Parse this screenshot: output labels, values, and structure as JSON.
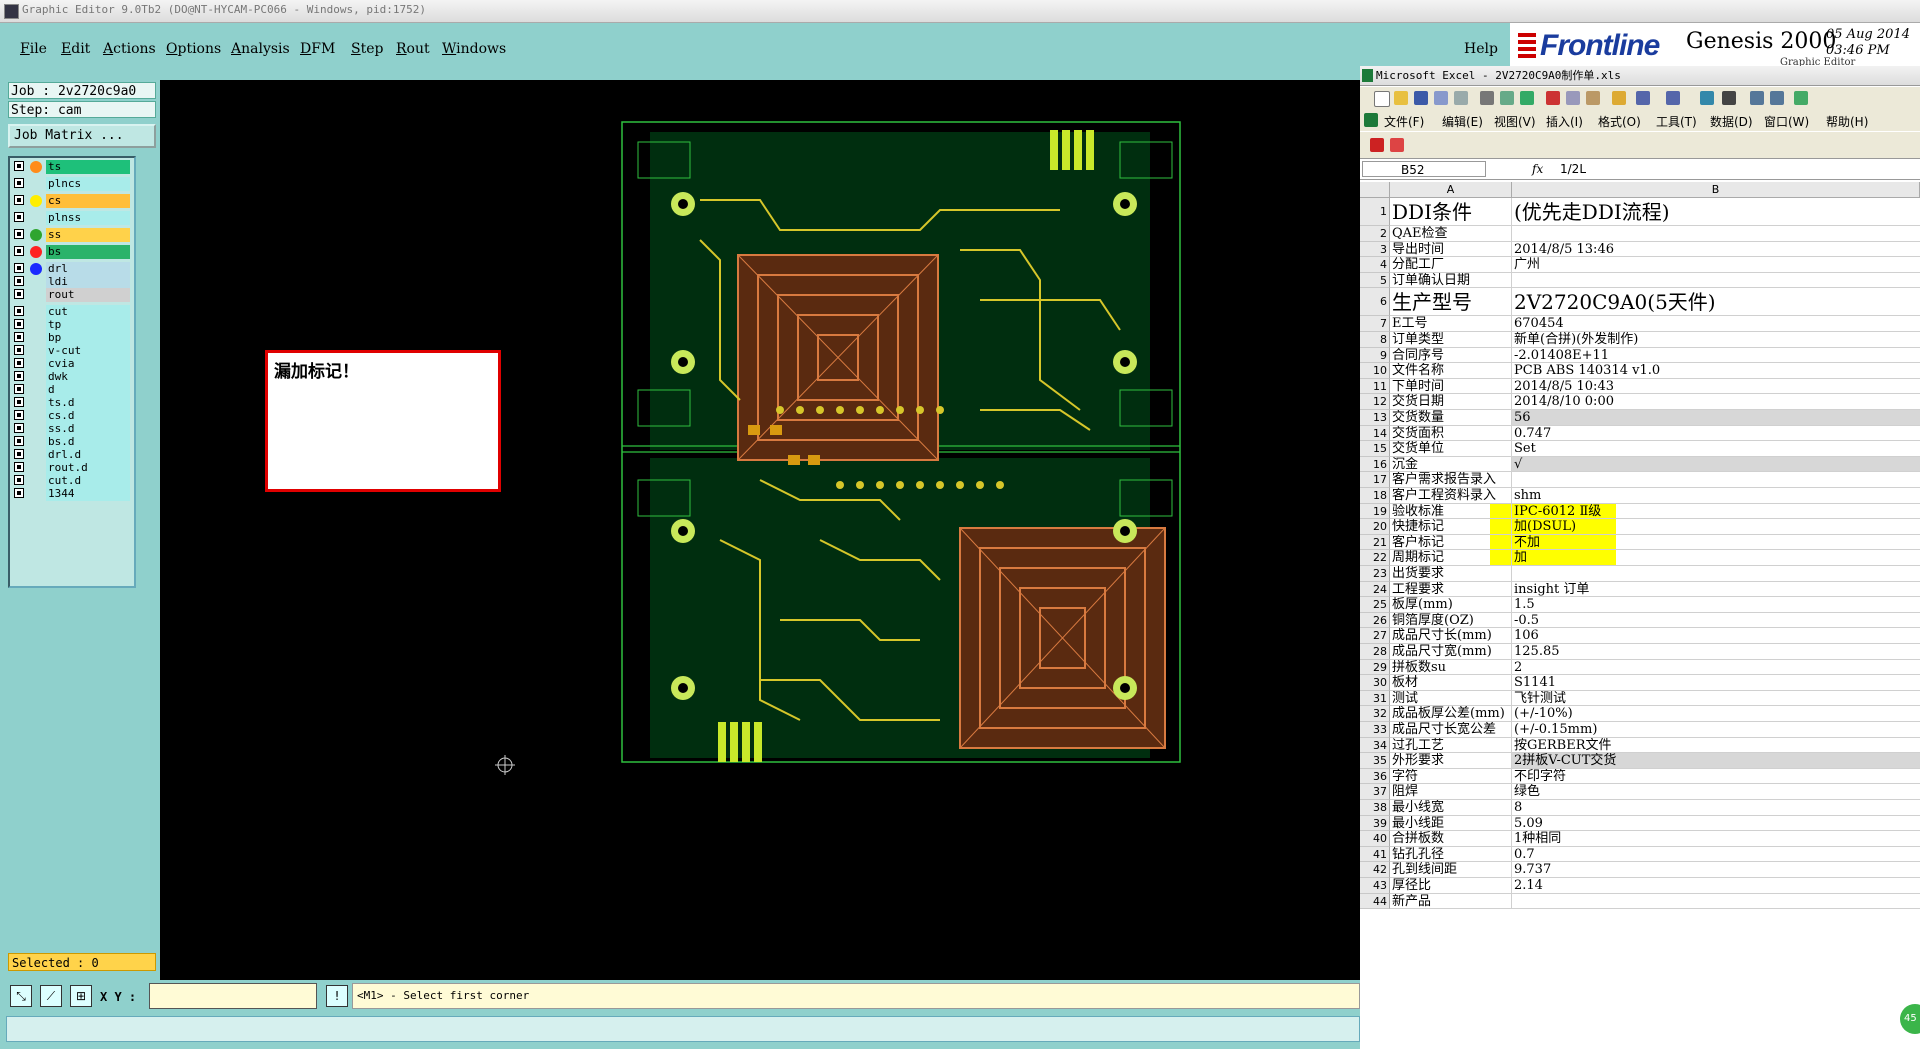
{
  "window": {
    "title": "Graphic Editor 9.0Tb2 (DO@NT-HYCAM-PC066 - Windows, pid:1752)"
  },
  "menu": {
    "items": [
      "File",
      "Edit",
      "Actions",
      "Options",
      "Analysis",
      "DFM",
      "Step",
      "Rout",
      "Windows"
    ],
    "help": "Help"
  },
  "logo": {
    "brand": "Frontline",
    "product": "Genesis 2000",
    "date": "05 Aug 2014",
    "time": "03:46 PM",
    "sub": "Graphic Editor"
  },
  "job": {
    "job_line": "Job : 2v2720c9a0",
    "step_line": "Step: cam",
    "matrix_button": "Job Matrix ..."
  },
  "layers": [
    {
      "name": "ts",
      "color": "#ff8c1a",
      "bg": "#1ec07a"
    },
    {
      "name": "plncs",
      "color": "",
      "bg": "#a8ecea"
    },
    {
      "name": "cs",
      "color": "#ffee00",
      "bg": "#ffbe3a"
    },
    {
      "name": "plnss",
      "color": "",
      "bg": "#a8ecea"
    },
    {
      "name": "ss",
      "color": "#2fa52f",
      "bg": "#ffd24a"
    },
    {
      "name": "bs",
      "color": "#ff2222",
      "bg": "#2ab36a"
    },
    {
      "name": "drl",
      "color": "#1a2aff",
      "bg": "#b8dce8"
    },
    {
      "name": "ldi",
      "color": "",
      "bg": "#b8dce8"
    },
    {
      "name": "rout",
      "color": "",
      "bg": "#d0d0d0"
    },
    {
      "name": "cut",
      "color": "",
      "bg": "#a8ecea"
    },
    {
      "name": "tp",
      "color": "",
      "bg": "#a8ecea"
    },
    {
      "name": "bp",
      "color": "",
      "bg": "#a8ecea"
    },
    {
      "name": "v-cut",
      "color": "",
      "bg": "#a8ecea"
    },
    {
      "name": "cvia",
      "color": "",
      "bg": "#a8ecea"
    },
    {
      "name": "dwk",
      "color": "",
      "bg": "#a8ecea"
    },
    {
      "name": "d",
      "color": "",
      "bg": "#a8ecea"
    },
    {
      "name": "ts.d",
      "color": "",
      "bg": "#a8ecea"
    },
    {
      "name": "cs.d",
      "color": "",
      "bg": "#a8ecea"
    },
    {
      "name": "ss.d",
      "color": "",
      "bg": "#a8ecea"
    },
    {
      "name": "bs.d",
      "color": "",
      "bg": "#a8ecea"
    },
    {
      "name": "drl.d",
      "color": "",
      "bg": "#a8ecea"
    },
    {
      "name": "rout.d",
      "color": "",
      "bg": "#a8ecea"
    },
    {
      "name": "cut.d",
      "color": "",
      "bg": "#a8ecea"
    },
    {
      "name": "1344",
      "color": "",
      "bg": "#a8ecea"
    }
  ],
  "selected": "Selected : 0",
  "popup": {
    "text": "漏加标记！"
  },
  "bottom": {
    "xy_label": "X Y :",
    "xy_value": "",
    "prompt": "<M1> - Select first corner",
    "info_button": "!"
  },
  "excel": {
    "title": "Microsoft Excel - 2V2720C9A0制作单.xls",
    "menu": [
      "文件(F)",
      "编辑(E)",
      "视图(V)",
      "插入(I)",
      "格式(O)",
      "工具(T)",
      "数据(D)",
      "窗口(W)",
      "帮助(H)"
    ],
    "cell_ref": "B52",
    "formula": "1/2L",
    "col_a": "A",
    "col_b": "B",
    "rows": [
      {
        "n": "1",
        "a": "DDI条件",
        "b": "(优先走DDI流程)",
        "big": true
      },
      {
        "n": "2",
        "a": "QAE检查",
        "b": ""
      },
      {
        "n": "3",
        "a": "导出时间",
        "b": "2014/8/5 13:46"
      },
      {
        "n": "4",
        "a": "分配工厂",
        "b": "广州"
      },
      {
        "n": "5",
        "a": "订单确认日期",
        "b": ""
      },
      {
        "n": "6",
        "a": "生产型号",
        "b": "2V2720C9A0(5天件)",
        "big": true
      },
      {
        "n": "7",
        "a": "E工号",
        "b": "670454"
      },
      {
        "n": "8",
        "a": "订单类型",
        "b": "新单(合拼)(外发制作)"
      },
      {
        "n": "9",
        "a": "合同序号",
        "b": "-2.01408E+11"
      },
      {
        "n": "10",
        "a": "文件名称",
        "b": "PCB ABS 140314 v1.0"
      },
      {
        "n": "11",
        "a": "下单时间",
        "b": "2014/8/5 10:43"
      },
      {
        "n": "12",
        "a": "交货日期",
        "b": "2014/8/10 0:00"
      },
      {
        "n": "13",
        "a": "交货数量",
        "b": "56",
        "grey": true
      },
      {
        "n": "14",
        "a": "交货面积",
        "b": "0.747"
      },
      {
        "n": "15",
        "a": "交货单位",
        "b": "Set"
      },
      {
        "n": "16",
        "a": "沉金",
        "b": "√",
        "grey": true
      },
      {
        "n": "17",
        "a": "客户需求报告录入",
        "b": ""
      },
      {
        "n": "18",
        "a": "客户工程资料录入",
        "b": "shm"
      },
      {
        "n": "19",
        "a": "验收标准",
        "b": "IPC-6012 Ⅱ级",
        "yellow": true
      },
      {
        "n": "20",
        "a": "快捷标记",
        "b": "加(DSUL)",
        "yellow": true
      },
      {
        "n": "21",
        "a": "客户标记",
        "b": "不加",
        "yellow": true
      },
      {
        "n": "22",
        "a": "周期标记",
        "b": "加",
        "yellow": true
      },
      {
        "n": "23",
        "a": "出货要求",
        "b": ""
      },
      {
        "n": "24",
        "a": "工程要求",
        "b": "insight 订单"
      },
      {
        "n": "25",
        "a": "板厚(mm)",
        "b": "1.5"
      },
      {
        "n": "26",
        "a": "铜箔厚度(OZ)",
        "b": "-0.5"
      },
      {
        "n": "27",
        "a": "成品尺寸长(mm)",
        "b": "106"
      },
      {
        "n": "28",
        "a": "成品尺寸宽(mm)",
        "b": "125.85"
      },
      {
        "n": "29",
        "a": "拼板数su",
        "b": "2"
      },
      {
        "n": "30",
        "a": "板材",
        "b": "S1141"
      },
      {
        "n": "31",
        "a": "测试",
        "b": "飞针测试"
      },
      {
        "n": "32",
        "a": "成品板厚公差(mm)",
        "b": "(+/-10%)"
      },
      {
        "n": "33",
        "a": "成品尺寸长宽公差",
        "b": "(+/-0.15mm)"
      },
      {
        "n": "34",
        "a": "过孔工艺",
        "b": "按GERBER文件"
      },
      {
        "n": "35",
        "a": "外形要求",
        "b": "2拼板V-CUT交货",
        "grey": true
      },
      {
        "n": "36",
        "a": "字符",
        "b": "不印字符"
      },
      {
        "n": "37",
        "a": "阻焊",
        "b": "绿色"
      },
      {
        "n": "38",
        "a": "最小线宽",
        "b": "8"
      },
      {
        "n": "39",
        "a": "最小线距",
        "b": "5.09"
      },
      {
        "n": "40",
        "a": "合拼板数",
        "b": "1种相同"
      },
      {
        "n": "41",
        "a": "钻孔孔径",
        "b": "0.7"
      },
      {
        "n": "42",
        "a": "孔到线间距",
        "b": "9.737"
      },
      {
        "n": "43",
        "a": "厚径比",
        "b": "2.14"
      },
      {
        "n": "44",
        "a": "新产品",
        "b": ""
      }
    ],
    "badge": "45"
  }
}
